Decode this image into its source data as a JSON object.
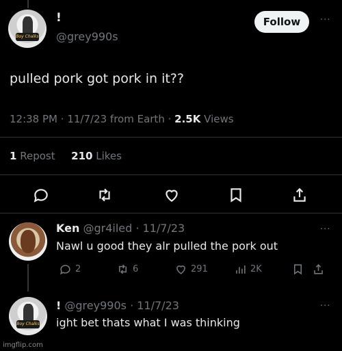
{
  "main_tweet": {
    "display_name": "!",
    "handle": "@grey990s",
    "follow_label": "Follow",
    "more_label": "···",
    "avatar_sign_text": "Boy Chalks",
    "text": "pulled pork got pork in it??",
    "time": "12:38 PM",
    "date": "11/7/23",
    "source": "from Earth",
    "views_count": "2.5K",
    "views_label": "Views",
    "repost_count": "1",
    "repost_label": "Repost",
    "likes_count": "210",
    "likes_label": "Likes"
  },
  "replies": [
    {
      "name": "Ken",
      "handle": "@gr4iled",
      "date": "11/7/23",
      "text": "Nawl u good they alr pulled the pork out",
      "reply_count": "2",
      "repost_count": "6",
      "like_count": "291",
      "view_count": "2K",
      "more_label": "···"
    },
    {
      "name": "!",
      "handle": "@grey990s",
      "date": "11/7/23",
      "text": "ight bet thats what I was thinking",
      "more_label": "···"
    }
  ],
  "watermark": "imgflip.com",
  "colors": {
    "background": "#000000",
    "primary_text": "#e7e9ea",
    "secondary_text": "#71767b",
    "divider": "#2f3336",
    "follow_bg": "#eff3f4"
  },
  "icons": [
    "reply-icon",
    "repost-icon",
    "like-icon",
    "views-icon",
    "bookmark-icon",
    "share-icon"
  ]
}
